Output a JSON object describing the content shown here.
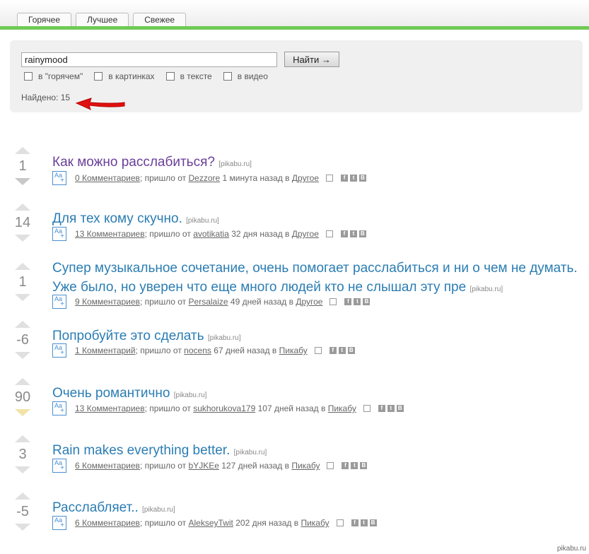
{
  "tabs": [
    "Горячее",
    "Лучшее",
    "Свежее"
  ],
  "search": {
    "value": "rainymood",
    "button": "Найти →",
    "checks": [
      "в \"горячем\"",
      "в картинках",
      "в тексте",
      "в видео"
    ],
    "found": "Найдено: 15"
  },
  "posts": [
    {
      "score": "1",
      "title": "Как можно расслабиться?",
      "src": "[pikabu.ru]",
      "comments": "0 Комментариев",
      "from": "; пришло от",
      "user": "Dezzore",
      "time": "1 минута назад в",
      "cat": "Другое"
    },
    {
      "score": "14",
      "title": "Для тех кому скучно.",
      "src": "[pikabu.ru]",
      "comments": "13 Комментариев",
      "from": "; пришло от",
      "user": "avotikatia",
      "time": "32 дня назад в",
      "cat": "Другое"
    },
    {
      "score": "1",
      "title": "Супер музыкальное сочетание, очень помогает расслабиться и ни о чем не думать. Уже было, но уверен что еще много людей кто не слышал эту пре",
      "src": "[pikabu.ru]",
      "comments": "9 Комментариев",
      "from": "; пришло от",
      "user": "Persalaize",
      "time": "49 дней назад в",
      "cat": "Другое"
    },
    {
      "score": "-6",
      "title": "Попробуйте это сделать",
      "src": "[pikabu.ru]",
      "comments": "1 Комментарий",
      "from": "; пришло от",
      "user": "nocens",
      "time": "67 дней назад в",
      "cat": "Пикабу"
    },
    {
      "score": "90",
      "title": "Очень романтично",
      "src": "[pikabu.ru]",
      "comments": "13 Комментариев",
      "from": "; пришло от",
      "user": "sukhorukova179",
      "time": "107 дней назад в",
      "cat": "Пикабу"
    },
    {
      "score": "3",
      "title": "Rain makes everything better.",
      "src": "[pikabu.ru]",
      "comments": "6 Комментариев",
      "from": "; пришло от",
      "user": "bYJKEe",
      "time": "127 дней назад в",
      "cat": "Пикабу"
    },
    {
      "score": "-5",
      "title": "Расслабляет..",
      "src": "[pikabu.ru]",
      "comments": "6 Комментариев",
      "from": "; пришло от",
      "user": "AlekseyTwit",
      "time": "202 дня назад в",
      "cat": "Пикабу"
    }
  ],
  "aa_label": "Aa",
  "aa_plus": "+",
  "share_icons": {
    "fb": "f",
    "tw": "t",
    "vk": "B"
  },
  "footer": "pikabu.ru",
  "colors": {
    "green": "#6fcb55",
    "link": "#2b7db3",
    "visited": "#6a3f9a",
    "arrow": "#e01010"
  }
}
